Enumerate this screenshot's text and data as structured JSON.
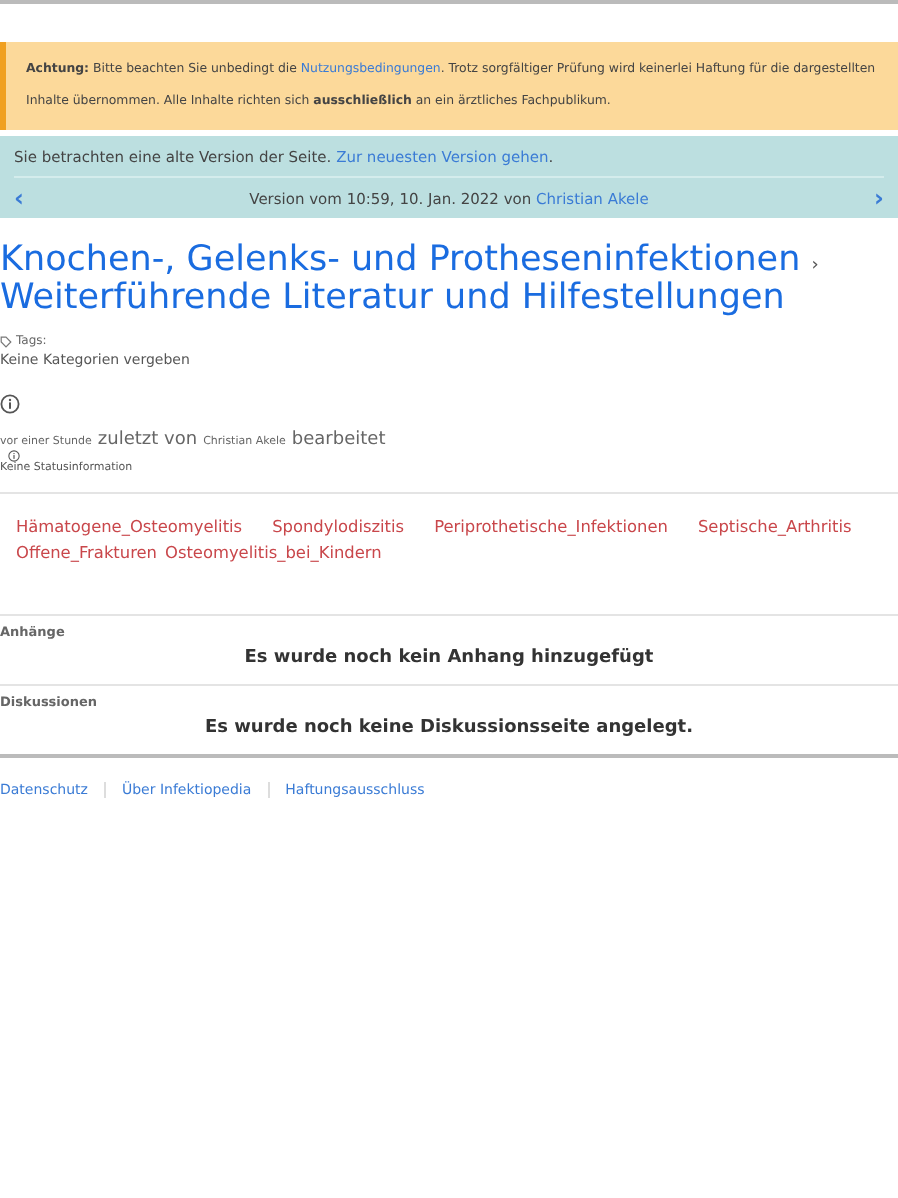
{
  "notice": {
    "label": "Achtung:",
    "before": "Bitte beachten Sie unbedingt die",
    "link": "Nutzungsbedingungen",
    "after": ". Trotz sorgfältiger Prüfung wird keinerlei Haftung für die dargestellten Inhalte übernommen. Alle Inhalte richten sich **ausschließlich** an ein ärztliches Fachpublikum."
  },
  "version_notice": {
    "text": "Sie betrachten eine alte Version der Seite.",
    "link": "Zur neuesten Version gehen",
    "suffix": ".",
    "prev": "‹",
    "next": "›",
    "version_text": "Version vom 10:59, 10. Jan. 2022 von",
    "author": "Christian Akele"
  },
  "title": {
    "parent": "Knochen-, Gelenks- und Protheseninfektionen",
    "separator": "›",
    "page": "Weiterführende Literatur und Hilfestellungen"
  },
  "tags": {
    "label": "Tags:",
    "value": "Keine Kategorien vergeben"
  },
  "edit_info": {
    "time": "vor einer Stunde",
    "middle": "zuletzt von",
    "user": "Christian Akele",
    "end": "bearbeitet",
    "status": "Keine Statusinformation"
  },
  "links": [
    "Hämatogene_Osteomyelitis",
    "Spondylodiszitis",
    "Periprothetische_Infektionen",
    "Septische_Arthritis",
    "Offene_Frakturen",
    "Osteomyelitis_bei_Kindern"
  ],
  "sections": [
    {
      "heading": "Anhänge",
      "message": "Es wurde noch kein Anhang hinzugefügt"
    },
    {
      "heading": "Diskussionen",
      "message": "Es wurde noch keine Diskussionsseite angelegt."
    }
  ],
  "footer": [
    "Datenschutz",
    "Über Infektiopedia",
    "Haftungsausschluss"
  ]
}
